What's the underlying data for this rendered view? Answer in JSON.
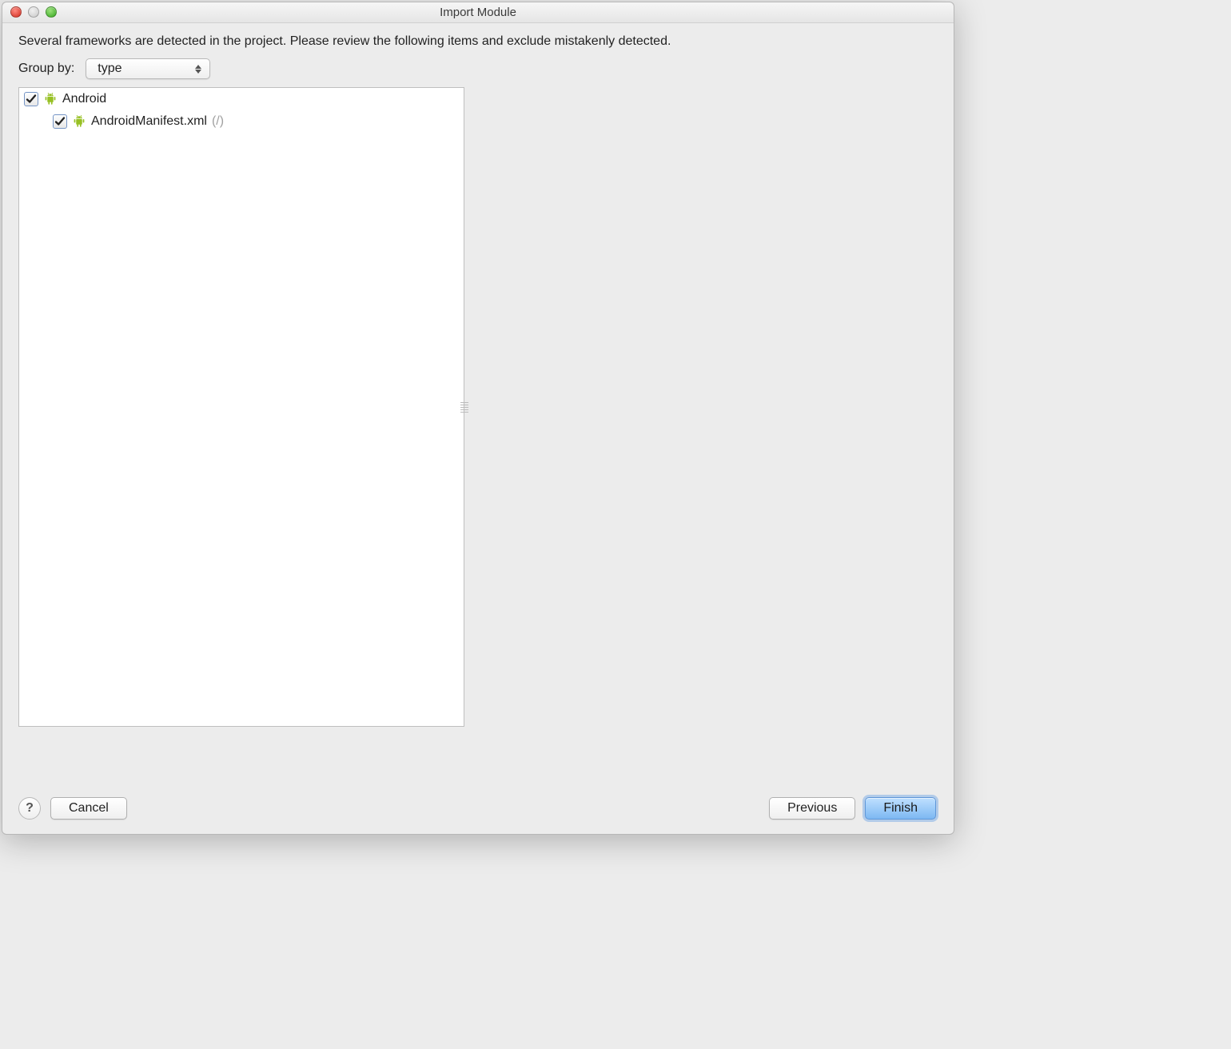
{
  "window": {
    "title": "Import Module"
  },
  "description": "Several frameworks are detected in the project. Please review the following items and exclude mistakenly detected.",
  "groupby": {
    "label": "Group by:",
    "value": "type"
  },
  "tree": {
    "items": [
      {
        "label": "Android",
        "checked": true,
        "children": [
          {
            "label": "AndroidManifest.xml",
            "suffix": "(/)",
            "checked": true
          }
        ]
      }
    ]
  },
  "footer": {
    "help": "?",
    "cancel": "Cancel",
    "previous": "Previous",
    "finish": "Finish"
  }
}
